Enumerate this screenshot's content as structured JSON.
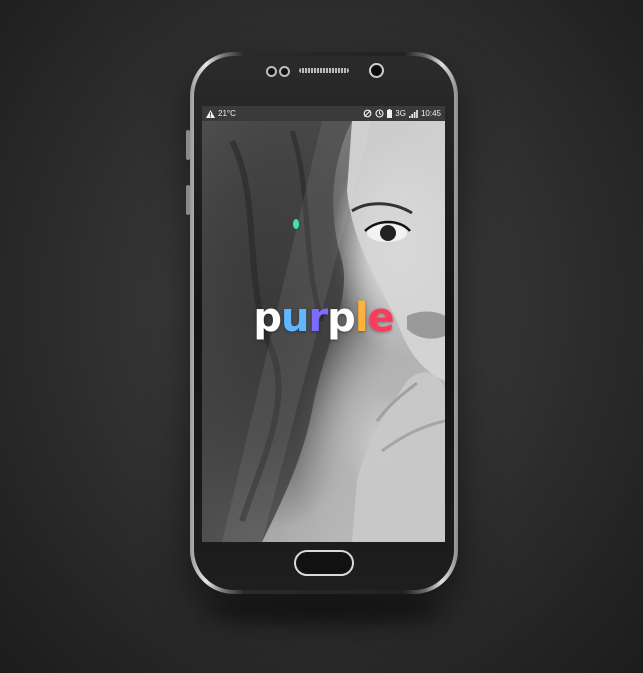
{
  "status_bar": {
    "temperature": "21°C",
    "network": "3G",
    "time": "10:45"
  },
  "splash": {
    "logo_text": "purple",
    "accent_color": "#3fe3b2"
  },
  "icons": {
    "warning": "warning-icon",
    "sync": "sync-icon",
    "alarm": "alarm-icon",
    "battery": "battery-icon",
    "signal": "signal-icon"
  }
}
